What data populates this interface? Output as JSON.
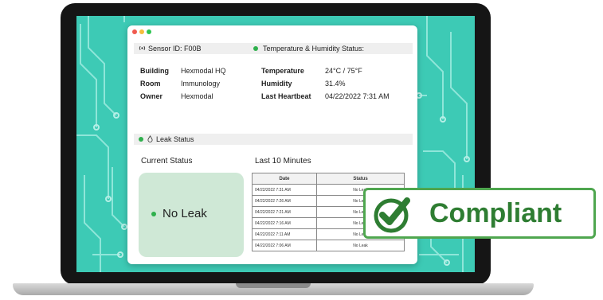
{
  "sensor": {
    "icon": "radio-signal-icon",
    "label": "Sensor ID: F00B"
  },
  "temperature_status": {
    "label": "Temperature & Humidity Status:",
    "dot_color": "#2fb04d"
  },
  "info_left": [
    {
      "key": "Building",
      "value": "Hexmodal HQ"
    },
    {
      "key": "Room",
      "value": "Immunology"
    },
    {
      "key": "Owner",
      "value": "Hexmodal"
    }
  ],
  "info_right": [
    {
      "key": "Temperature",
      "value": "24°C / 75°F"
    },
    {
      "key": "Humidity",
      "value": "31.4%"
    },
    {
      "key": "Last Heartbeat",
      "value": "04/22/2022 7:31 AM"
    }
  ],
  "leak_status": {
    "icon": "droplet-icon",
    "label": "Leak Status",
    "dot_color": "#2fb04d"
  },
  "current_status": {
    "title": "Current Status",
    "value": "No Leak"
  },
  "history": {
    "title": "Last 10 Minutes",
    "columns": [
      "Date",
      "Status"
    ],
    "rows": [
      [
        "04/22/2022 7:31 AM",
        "No Leak"
      ],
      [
        "04/22/2022 7:26 AM",
        "No Leak"
      ],
      [
        "04/22/2022 7:21 AM",
        "No Leak"
      ],
      [
        "04/22/2022 7:16 AM",
        "No Leak"
      ],
      [
        "04/22/2022 7:11 AM",
        "No Leak"
      ],
      [
        "04/22/2022 7:06 AM",
        "No Leak"
      ]
    ]
  },
  "badge": {
    "icon": "check-circle-icon",
    "label": "Compliant",
    "color": "#2e7d32"
  },
  "colors": {
    "screen_background": "#3dcab5",
    "leak_panel": "#cfe8d6"
  }
}
